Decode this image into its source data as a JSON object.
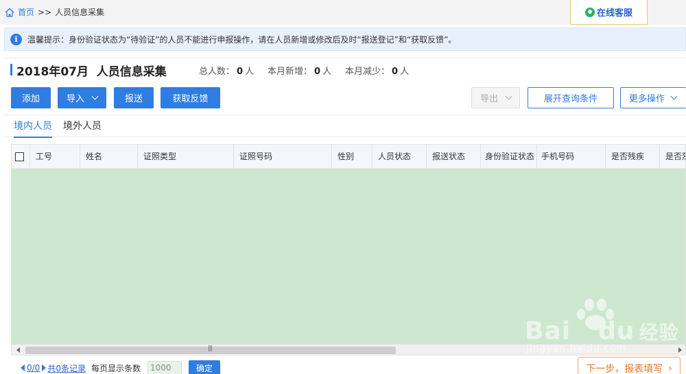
{
  "breadcrumb": {
    "home": "首页",
    "separator": ">>",
    "current": "人员信息采集"
  },
  "service": {
    "label": "在线客服"
  },
  "notice": {
    "icon": "info-icon",
    "text": "温馨提示：身份验证状态为“待验证”的人员不能进行申报操作，请在人员新增或修改后及时“报送登记”和“获取反馈”。"
  },
  "header": {
    "title": "2018年07月  人员信息采集",
    "stats": [
      {
        "label": "总人数：",
        "value": "0",
        "unit": "人"
      },
      {
        "label": "本月新增：",
        "value": "0",
        "unit": "人"
      },
      {
        "label": "本月减少：",
        "value": "0",
        "unit": "人"
      }
    ]
  },
  "toolbar": {
    "add": "添加",
    "import": "导入",
    "submit": "报送",
    "feedback": "获取反馈",
    "export": "导出",
    "expand_query": "展开查询条件",
    "more": "更多操作"
  },
  "tabs": [
    {
      "label": "境内人员",
      "active": true
    },
    {
      "label": "境外人员",
      "active": false
    }
  ],
  "table": {
    "columns": [
      "工号",
      "姓名",
      "证照类型",
      "证照号码",
      "性别",
      "人员状态",
      "报送状态",
      "身份验证状态",
      "手机号码",
      "是否残疾",
      "是否烈"
    ],
    "rows": []
  },
  "pager": {
    "page": "0/0",
    "total": "共0条记录",
    "per_page_label": "每页显示条数",
    "per_page_value": "1000",
    "confirm": "确定"
  },
  "next": {
    "label": "下一步，报表填写"
  },
  "watermark": {
    "text": "Bai",
    "text2": "du",
    "brand_cn": "经验",
    "url": "jingyan.baidu.com"
  },
  "colors": {
    "primary": "#2f7de1",
    "grid_body": "#cde8cf",
    "next_accent": "#e8732b"
  }
}
